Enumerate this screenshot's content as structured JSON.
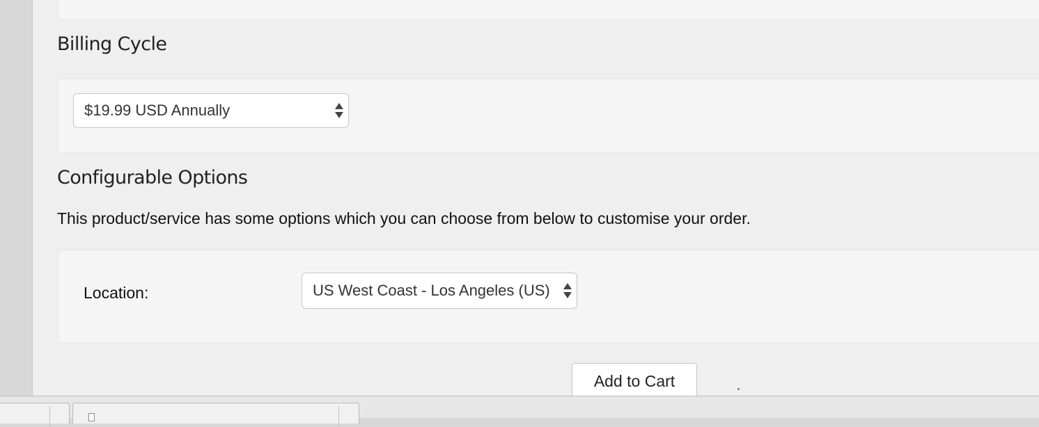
{
  "top_section": {
    "partial_text": "...p...g..."
  },
  "billing": {
    "heading": "Billing Cycle",
    "select_value": "$19.99 USD Annually"
  },
  "configurable_options": {
    "heading": "Configurable Options",
    "description": "This product/service has some options which you can choose from below to customise your order.",
    "location_label": "Location:",
    "location_value": "US West Coast - Los Angeles (US)"
  },
  "actions": {
    "add_to_cart_label": "Add to Cart"
  },
  "icons": {
    "select_arrows": "up-down-arrows-icon",
    "tab_document": "document-icon"
  }
}
